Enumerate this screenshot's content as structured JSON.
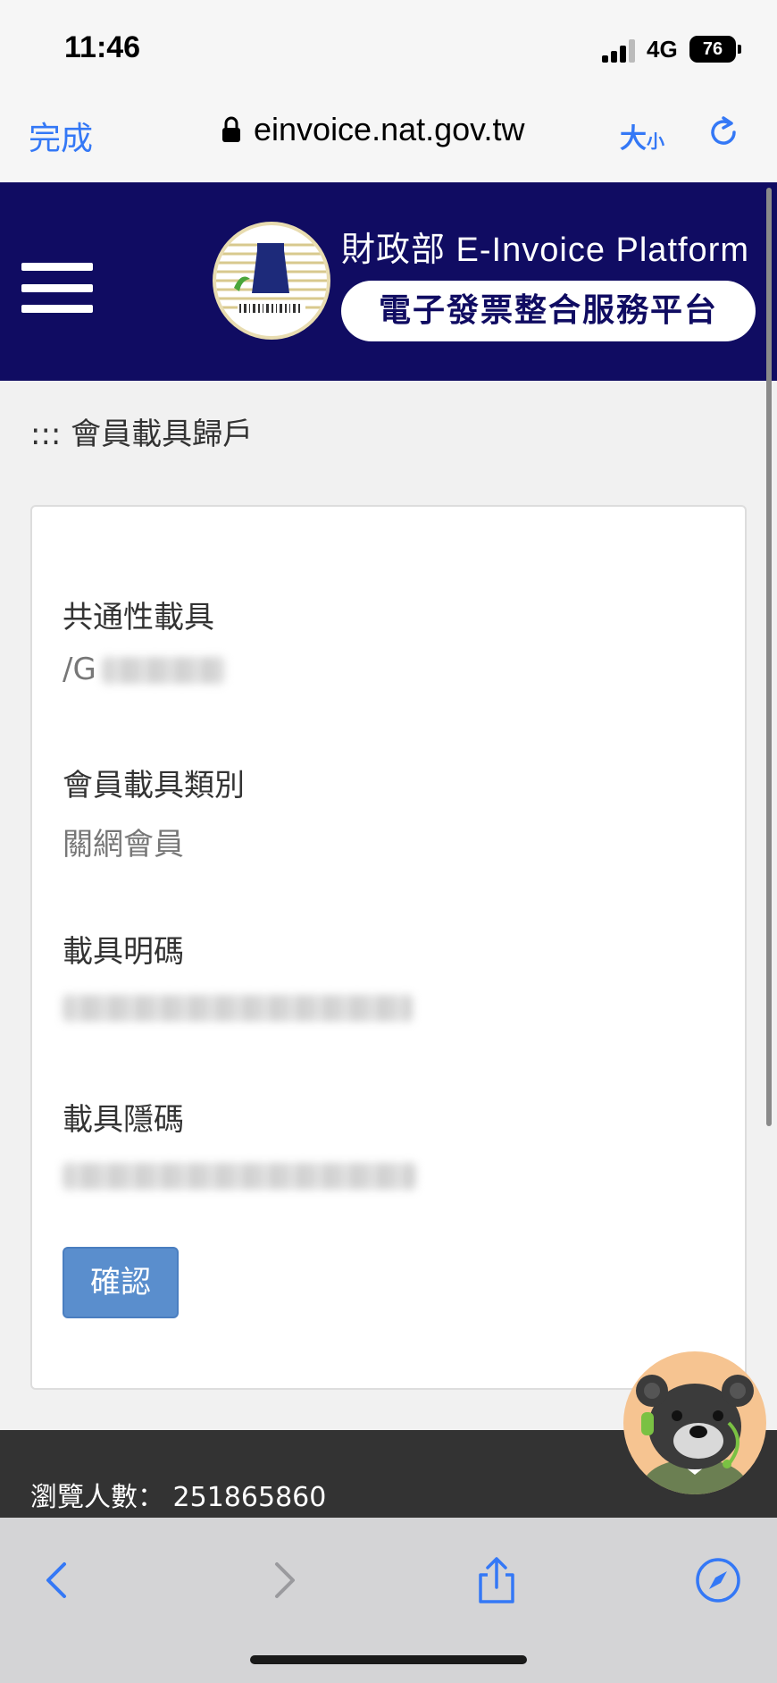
{
  "status_bar": {
    "time": "11:46",
    "network": "4G",
    "battery": "76"
  },
  "browser": {
    "done_label": "完成",
    "url": "einvoice.nat.gov.tw",
    "text_size_label_big": "大",
    "text_size_label_small": "小"
  },
  "site": {
    "title": "財政部 E-Invoice Platform",
    "subtitle": "電子發票整合服務平台"
  },
  "page": {
    "breadcrumb": "::: 會員載具歸戶",
    "fields": [
      {
        "label": "共通性載具",
        "value": "/G"
      },
      {
        "label": "會員載具類別",
        "value": "關網會員"
      },
      {
        "label": "載具明碼",
        "value": ""
      },
      {
        "label": "載具隱碼",
        "value": ""
      }
    ],
    "confirm_label": "確認"
  },
  "footer": {
    "visitors_label": "瀏覽人數：",
    "visitors_count": "251865860"
  },
  "colors": {
    "header_bg": "#100c62",
    "link_blue": "#3478f6",
    "button_blue": "#5a8ecd"
  },
  "icons": [
    "lock-icon",
    "reload-icon",
    "menu-icon",
    "back-icon",
    "forward-icon",
    "share-icon",
    "compass-icon"
  ]
}
